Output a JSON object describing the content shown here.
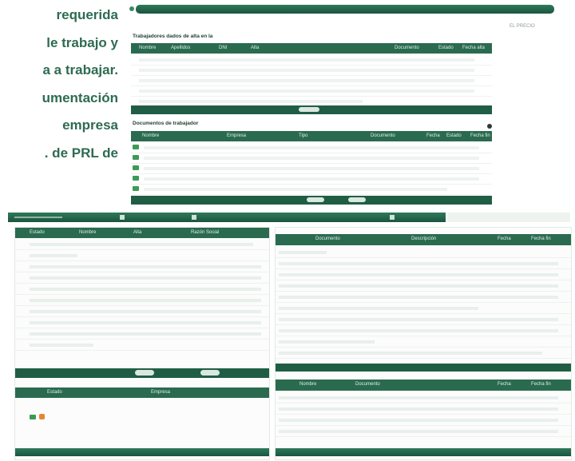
{
  "side_text": {
    "lines": [
      "requerida",
      "le trabajo y",
      "a a trabajar.",
      "umentación",
      "empresa",
      ". de PRL de"
    ]
  },
  "colors": {
    "brand_green": "#1f5e45",
    "header_green": "#2a6b50",
    "side_text": "#2e6b52",
    "accent_orange": "#e6862e"
  },
  "top_panel": {
    "corner_label": "EL PRECIO",
    "workers_title": "Trabajadores dados de alta en la",
    "workers_columns": [
      "Nombre",
      "Apellidos",
      "DNI",
      "Alta",
      "Documento",
      "Estado",
      "Fecha alta"
    ],
    "documents_title": "Documentos de trabajador",
    "documents_columns": [
      "Nombre",
      "Empresa",
      "Tipo",
      "Documento",
      "Fecha",
      "Estado",
      "Fecha fin"
    ]
  },
  "left_panel": {
    "columns": [
      "Estado",
      "Nombre",
      "Alta",
      "Razón Social"
    ],
    "footer_columns": [
      "Estado",
      "Empresa"
    ]
  },
  "right_panel": {
    "columns": [
      "Documento",
      "Descripción",
      "Fecha",
      "Fecha fin"
    ],
    "lower_columns": [
      "Nombre",
      "Documento",
      "Fecha",
      "Fecha fin"
    ]
  }
}
